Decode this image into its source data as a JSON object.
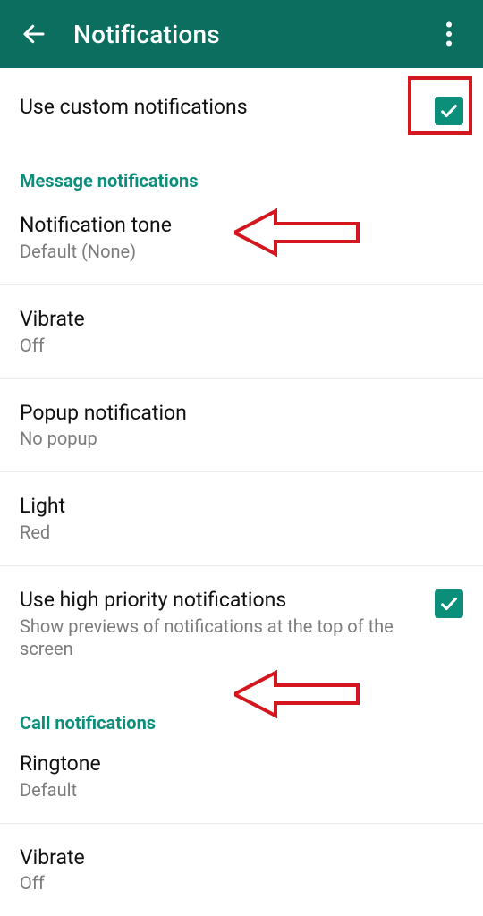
{
  "colors": {
    "appbar": "#0b6e5f",
    "accent": "#0b8f7b",
    "callout": "#d4171e",
    "secondary_text": "#7c7c7c"
  },
  "header": {
    "title": "Notifications",
    "back_icon": "back-arrow",
    "overflow_icon": "dots-vertical"
  },
  "toggles": {
    "use_custom": {
      "label": "Use custom notifications",
      "checked": true
    }
  },
  "sections": {
    "message": {
      "header": "Message notifications",
      "items": [
        {
          "id": "notification_tone",
          "primary": "Notification tone",
          "secondary": "Default (None)"
        },
        {
          "id": "vibrate",
          "primary": "Vibrate",
          "secondary": "Off"
        },
        {
          "id": "popup",
          "primary": "Popup notification",
          "secondary": "No popup"
        },
        {
          "id": "light",
          "primary": "Light",
          "secondary": "Red"
        },
        {
          "id": "high_priority",
          "primary": "Use high priority notifications",
          "secondary": "Show previews of notifications at the top of the screen",
          "checked": true
        }
      ]
    },
    "call": {
      "header": "Call notifications",
      "items": [
        {
          "id": "ringtone",
          "primary": "Ringtone",
          "secondary": "Default"
        },
        {
          "id": "call_vibrate",
          "primary": "Vibrate",
          "secondary": "Off"
        }
      ]
    }
  }
}
